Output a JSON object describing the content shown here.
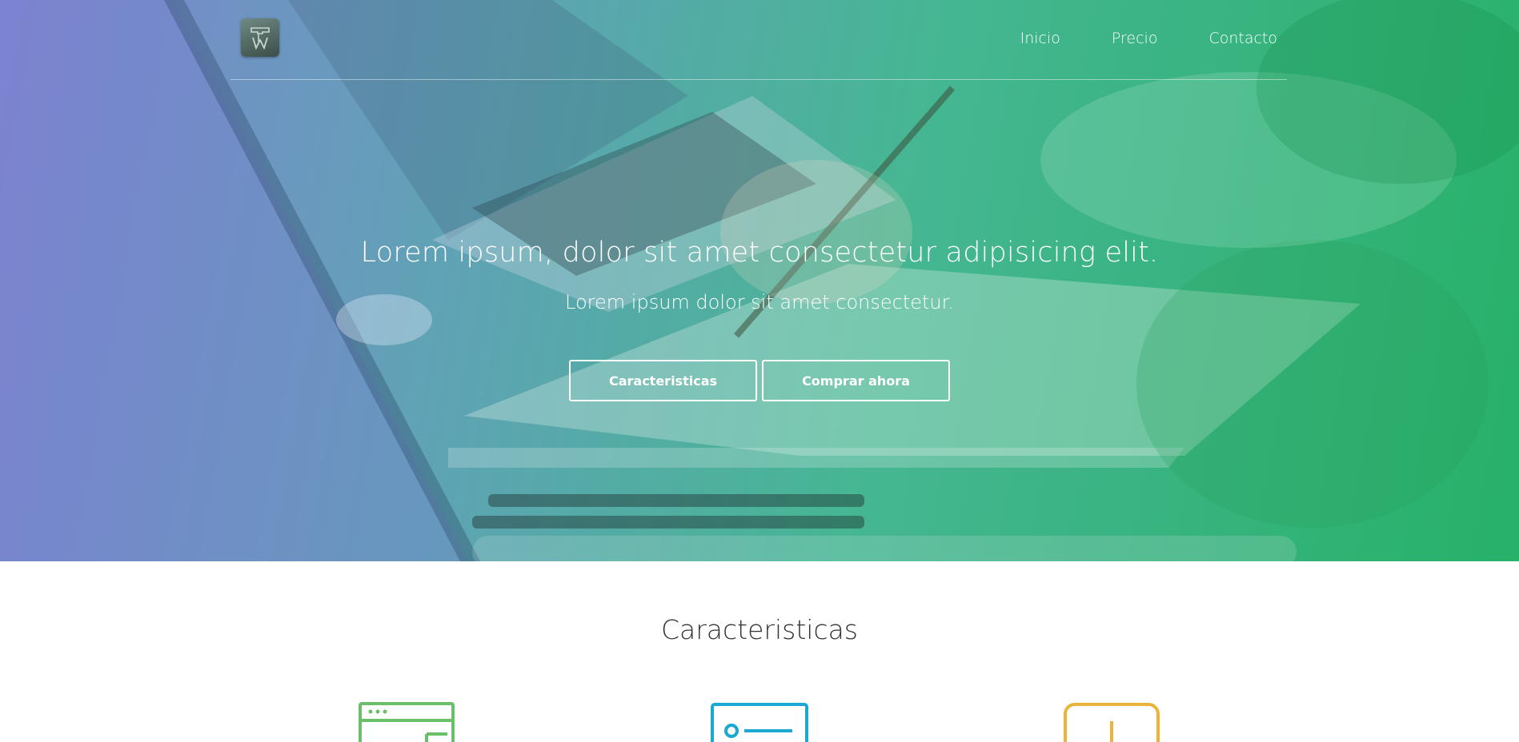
{
  "nav": {
    "items": [
      {
        "label": "Inicio"
      },
      {
        "label": "Precio"
      },
      {
        "label": "Contacto"
      }
    ]
  },
  "hero": {
    "title": "Lorem ipsum, dolor sit amet consectetur adipisicing elit.",
    "subtitle": "Lorem ipsum dolor sit amet consectetur.",
    "buttons": {
      "features_label": "Caracteristicas",
      "buy_label": "Comprar ahora"
    }
  },
  "features": {
    "title": "Caracteristicas",
    "icons": [
      {
        "name": "browser-window-icon",
        "color": "#6abf69"
      },
      {
        "name": "id-card-icon",
        "color": "#1aa9d3"
      },
      {
        "name": "mobile-device-icon",
        "color": "#e8b53a"
      }
    ]
  },
  "colors": {
    "hero_gradient_start": "#7a7fcf",
    "hero_gradient_end": "#1fae63",
    "text_on_hero": "#ffffff",
    "heading_dark": "#333333"
  }
}
